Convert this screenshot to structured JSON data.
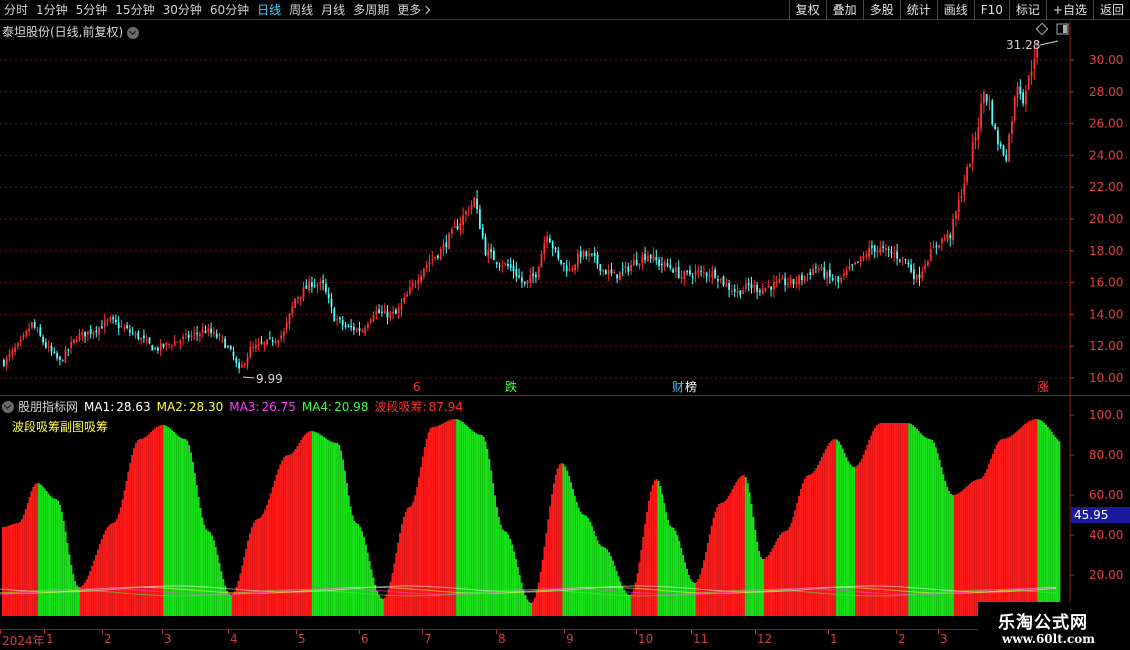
{
  "toolbar": {
    "periods": [
      {
        "label": "分时",
        "active": false
      },
      {
        "label": "1分钟",
        "active": false
      },
      {
        "label": "5分钟",
        "active": false
      },
      {
        "label": "15分钟",
        "active": false
      },
      {
        "label": "30分钟",
        "active": false
      },
      {
        "label": "60分钟",
        "active": false
      },
      {
        "label": "日线",
        "active": true
      },
      {
        "label": "周线",
        "active": false
      },
      {
        "label": "月线",
        "active": false
      },
      {
        "label": "多周期",
        "active": false
      },
      {
        "label": "更多",
        "active": false
      }
    ],
    "tools": [
      "复权",
      "叠加",
      "多股",
      "统计",
      "画线",
      "F10",
      "标记",
      "+自选",
      "返回"
    ]
  },
  "main_chart": {
    "title": "泰坦股份(日线,前复权)",
    "high_label": "31.28",
    "low_label": "9.99",
    "y_ticks": [
      "30.00",
      "28.00",
      "26.00",
      "24.00",
      "22.00",
      "20.00",
      "18.00",
      "16.00",
      "14.00",
      "12.00",
      "10.00"
    ],
    "markers": [
      {
        "label": "6",
        "color": "#ff3030"
      },
      {
        "label": "跌",
        "color": "#40ff40"
      },
      {
        "label": "财",
        "color": "#40c8ff"
      },
      {
        "label": "榜",
        "color": "#ffffff"
      },
      {
        "label": "涨",
        "color": "#ff4040"
      }
    ],
    "colors": {
      "up": "#ff3232",
      "down": "#54ffff",
      "grid": "#7a1010"
    }
  },
  "indicator": {
    "name": "股朋指标网",
    "legend": [
      {
        "label": "MA1:",
        "value": "28.63",
        "color": "#ffffff"
      },
      {
        "label": "MA2:",
        "value": "28.30",
        "color": "#ffff40"
      },
      {
        "label": "MA3:",
        "value": "26.75",
        "color": "#ff40ff"
      },
      {
        "label": "MA4:",
        "value": "20.98",
        "color": "#40ff40"
      },
      {
        "label": "波段吸筹:",
        "value": "87.94",
        "color": "#ff3030"
      }
    ],
    "subtitle": "波段吸筹副图吸筹",
    "y_ticks": [
      "100.0",
      "80.00",
      "60.00",
      "40.00",
      "20.00"
    ],
    "cursor_value": "45.95",
    "colors": {
      "rise": "#ff1a1a",
      "fall": "#18e018",
      "cursor_bg": "#1a1aa0"
    }
  },
  "time_axis": {
    "labels": [
      "2024年",
      "1",
      "2",
      "3",
      "4",
      "5",
      "6",
      "7",
      "8",
      "9",
      "10",
      "11",
      "12",
      "1",
      "2",
      "3"
    ]
  },
  "watermark": {
    "text": "乐淘公式网",
    "url": "www.60lt.com"
  },
  "chart_data": {
    "type": "candlestick",
    "title": "泰坦股份(日线,前复权)",
    "ylim": [
      9.5,
      31.5
    ],
    "y_ticks": [
      10,
      12,
      14,
      16,
      18,
      20,
      22,
      24,
      26,
      28,
      30
    ],
    "annotations": [
      {
        "label": "31.28"
      },
      {
        "label": "9.99"
      }
    ],
    "close_anchors": [
      [
        0,
        11.0
      ],
      [
        6,
        12.2
      ],
      [
        10,
        13.4
      ],
      [
        15,
        12.0
      ],
      [
        20,
        11.0
      ],
      [
        26,
        12.6
      ],
      [
        32,
        13.0
      ],
      [
        38,
        13.6
      ],
      [
        42,
        13.2
      ],
      [
        48,
        12.6
      ],
      [
        54,
        11.8
      ],
      [
        60,
        12.2
      ],
      [
        66,
        12.6
      ],
      [
        72,
        13.0
      ],
      [
        78,
        12.4
      ],
      [
        82,
        11.3
      ],
      [
        84,
        10.4
      ],
      [
        88,
        11.8
      ],
      [
        94,
        12.2
      ],
      [
        100,
        12.8
      ],
      [
        104,
        15.0
      ],
      [
        110,
        16.0
      ],
      [
        114,
        15.8
      ],
      [
        118,
        13.8
      ],
      [
        122,
        13.2
      ],
      [
        128,
        13.0
      ],
      [
        132,
        14.2
      ],
      [
        136,
        14.0
      ],
      [
        140,
        14.0
      ],
      [
        146,
        15.8
      ],
      [
        150,
        17.0
      ],
      [
        156,
        18.0
      ],
      [
        162,
        19.6
      ],
      [
        168,
        21.2
      ],
      [
        172,
        18.0
      ],
      [
        176,
        17.4
      ],
      [
        182,
        16.8
      ],
      [
        186,
        15.8
      ],
      [
        190,
        16.6
      ],
      [
        194,
        19.2
      ],
      [
        198,
        17.4
      ],
      [
        202,
        16.8
      ],
      [
        206,
        17.8
      ],
      [
        210,
        17.6
      ],
      [
        214,
        16.8
      ],
      [
        218,
        16.4
      ],
      [
        222,
        16.8
      ],
      [
        226,
        17.4
      ],
      [
        230,
        17.8
      ],
      [
        234,
        17.2
      ],
      [
        238,
        17.0
      ],
      [
        242,
        16.4
      ],
      [
        246,
        16.6
      ],
      [
        250,
        16.6
      ],
      [
        254,
        16.6
      ],
      [
        258,
        15.8
      ],
      [
        262,
        15.4
      ],
      [
        266,
        15.8
      ],
      [
        270,
        15.6
      ],
      [
        274,
        15.8
      ],
      [
        278,
        16.0
      ],
      [
        282,
        16.0
      ],
      [
        286,
        16.4
      ],
      [
        290,
        17.0
      ],
      [
        294,
        16.4
      ],
      [
        298,
        16.0
      ],
      [
        302,
        16.8
      ],
      [
        306,
        17.4
      ],
      [
        310,
        18.2
      ],
      [
        314,
        18.0
      ],
      [
        318,
        17.8
      ],
      [
        322,
        17.4
      ],
      [
        326,
        16.2
      ],
      [
        330,
        17.6
      ],
      [
        334,
        18.6
      ],
      [
        338,
        19.0
      ],
      [
        340,
        20.4
      ],
      [
        344,
        23.0
      ],
      [
        348,
        26.0
      ],
      [
        350,
        28.0
      ],
      [
        352,
        27.2
      ],
      [
        354,
        25.4
      ],
      [
        356,
        24.4
      ],
      [
        358,
        24.0
      ],
      [
        360,
        26.4
      ],
      [
        362,
        28.6
      ],
      [
        364,
        27.6
      ],
      [
        366,
        28.8
      ],
      [
        368,
        30.4
      ]
    ]
  }
}
